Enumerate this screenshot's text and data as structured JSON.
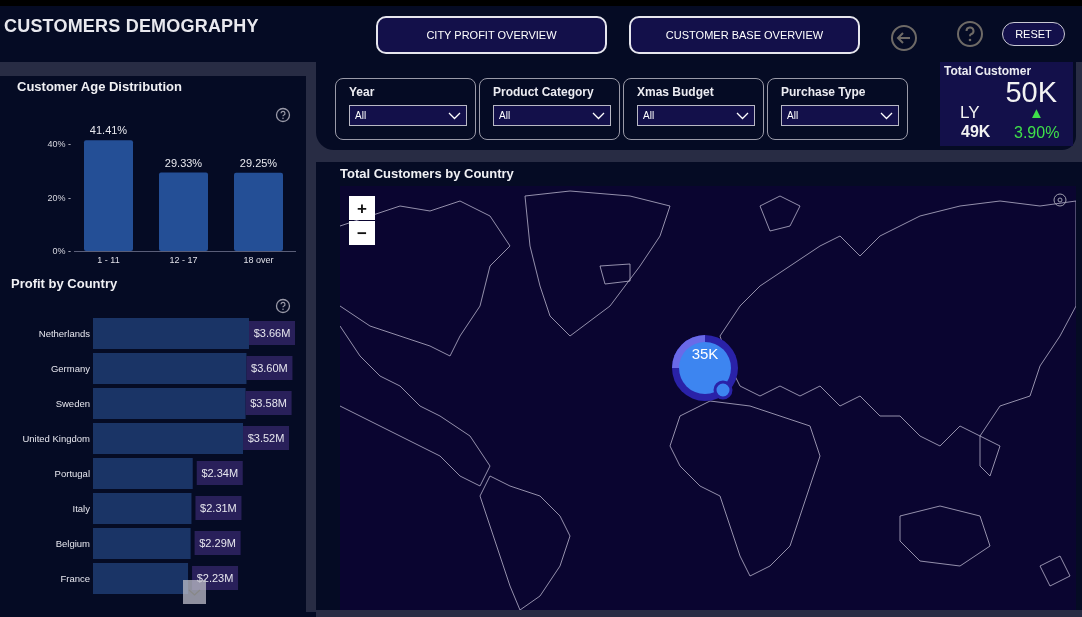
{
  "header": {
    "title": "CUSTOMERS DEMOGRAPHY"
  },
  "nav_buttons": [
    {
      "label": "CITY PROFIT OVERVIEW"
    },
    {
      "label": "CUSTOMER BASE OVERVIEW"
    }
  ],
  "reset_button": {
    "label": "RESET"
  },
  "age_chart": {
    "title": "Customer Age Distribution",
    "chart_data": {
      "type": "bar",
      "categories": [
        "1 - 11",
        "12 - 17",
        "18 over"
      ],
      "values": [
        41.41,
        29.33,
        29.25
      ],
      "ylim": [
        0,
        42
      ],
      "yticks": [
        {
          "value": 0,
          "label": "0% -"
        },
        {
          "value": 20,
          "label": "20% -"
        },
        {
          "value": 40,
          "label": "40% -"
        }
      ],
      "value_labels": [
        "41.41%",
        "29.33%",
        "29.25%"
      ]
    }
  },
  "profit_chart": {
    "title": "Profit by Country",
    "chart_data": {
      "type": "bar",
      "orientation": "horizontal",
      "categories": [
        "Netherlands",
        "Germany",
        "Sweden",
        "United Kingdom",
        "Portugal",
        "Italy",
        "Belgium",
        "France"
      ],
      "values": [
        3.66,
        3.6,
        3.58,
        3.52,
        2.34,
        2.31,
        2.29,
        2.23
      ],
      "value_labels": [
        "$3.66M",
        "$3.60M",
        "$3.58M",
        "$3.52M",
        "$2.34M",
        "$2.31M",
        "$2.29M",
        "$2.23M"
      ]
    }
  },
  "filters": [
    {
      "label": "Year",
      "value": "All"
    },
    {
      "label": "Product Category",
      "value": "All"
    },
    {
      "label": "Xmas Budget",
      "value": "All"
    },
    {
      "label": "Purchase Type",
      "value": "All"
    }
  ],
  "kpi": {
    "title": "Total Customer",
    "value": "50K",
    "ly_label": "LY",
    "ly_value": "49K",
    "change": "3.90%",
    "trend_icon": "▲"
  },
  "map": {
    "title": "Total Customers by Country",
    "zoom_in": "+",
    "zoom_out": "−",
    "bubbles": [
      {
        "label": "35K"
      }
    ]
  }
}
